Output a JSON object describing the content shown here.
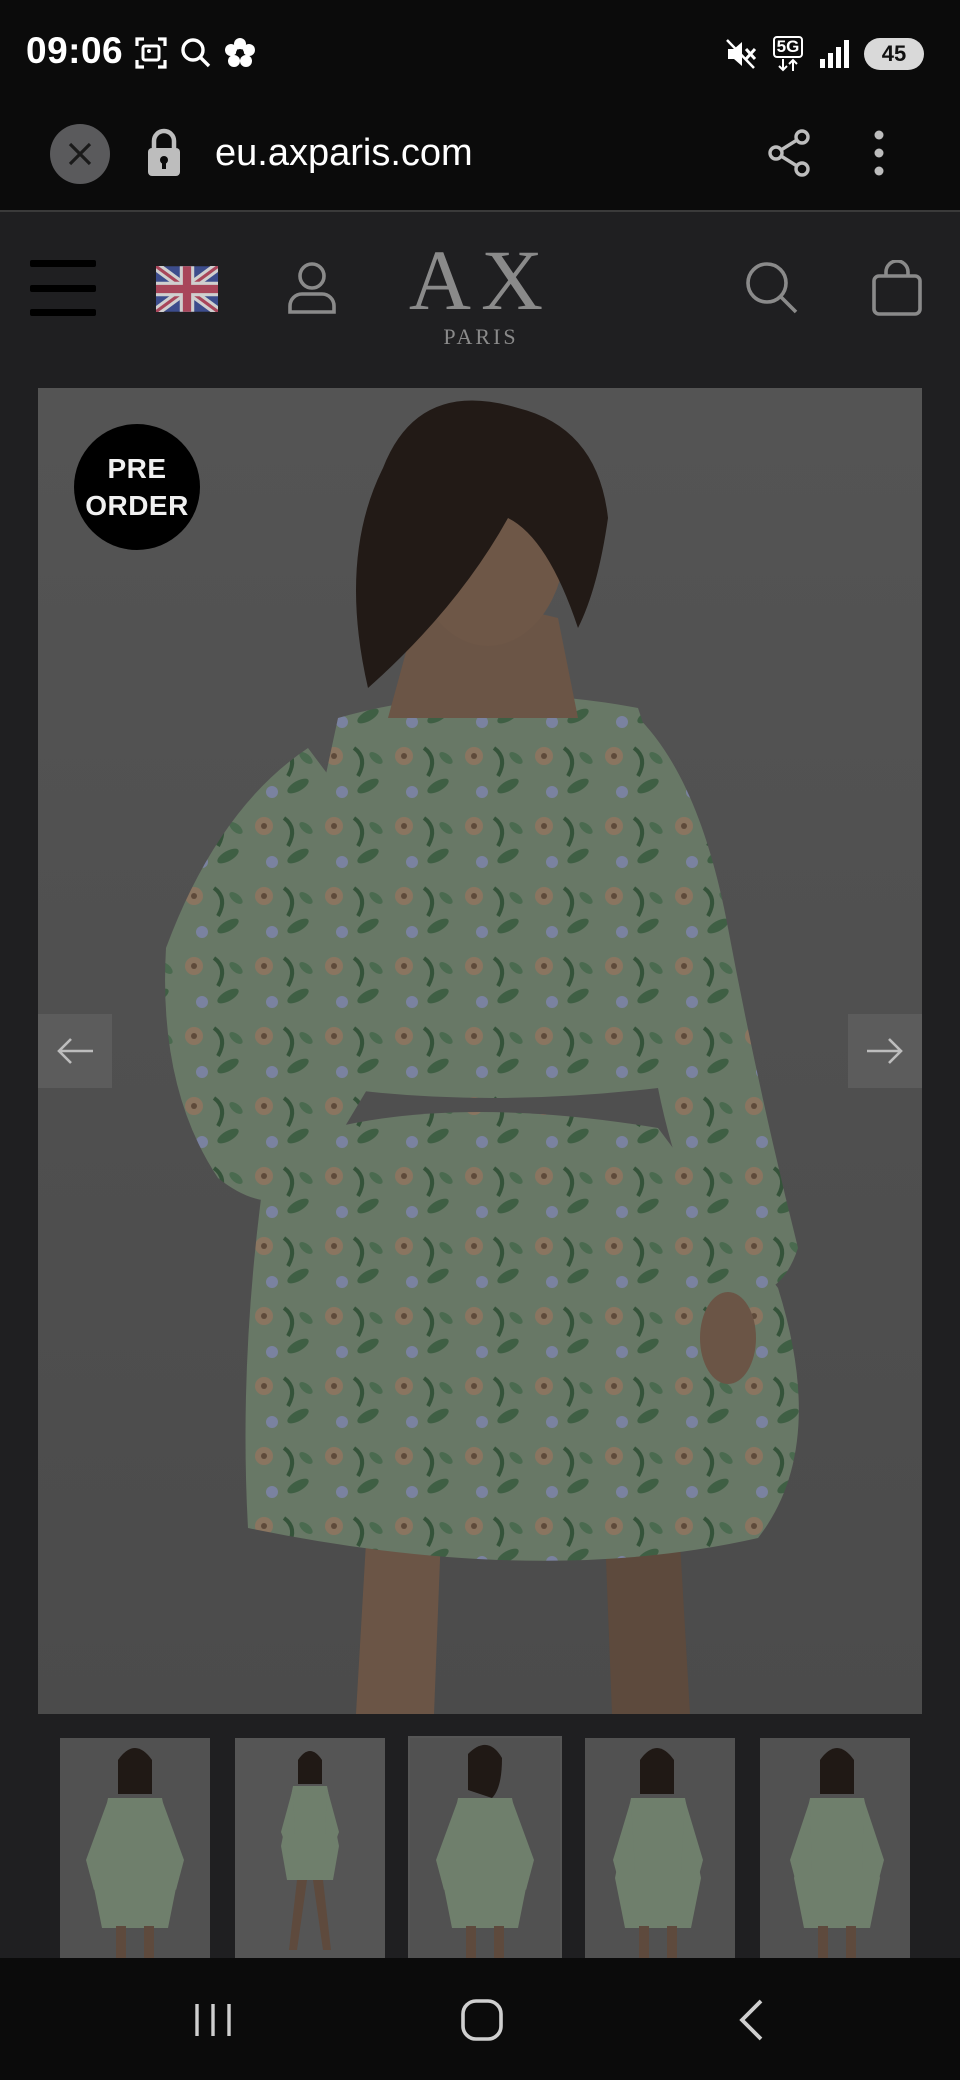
{
  "status_bar": {
    "time": "09:06",
    "network": "5G",
    "battery": "45",
    "icons_left": [
      "screenshot-icon",
      "search-icon",
      "flower-icon"
    ],
    "icons_right": [
      "mute-icon",
      "5g-icon",
      "signal-icon",
      "battery-icon"
    ]
  },
  "browser": {
    "url": "eu.axparis.com",
    "icons": [
      "close-icon",
      "lock-icon",
      "share-icon",
      "more-icon"
    ]
  },
  "site_header": {
    "logo_main": "AX",
    "logo_sub": "PARIS",
    "icons": [
      "hamburger-icon",
      "uk-flag-icon",
      "account-icon",
      "search-icon",
      "shopping-bag-icon"
    ]
  },
  "product": {
    "badge_line1": "PRE",
    "badge_line2": "ORDER",
    "image_alt": "Woman wearing a sage green floral print chiffon mini dress with ruffled long sleeves, back view",
    "thumbnails": [
      {
        "label": "front-view",
        "active": false
      },
      {
        "label": "full-length",
        "active": false
      },
      {
        "label": "back-view",
        "active": true
      },
      {
        "label": "side-view",
        "active": false
      },
      {
        "label": "three-quarter",
        "active": false
      }
    ]
  },
  "colors": {
    "overlay_dark": "#1f1f21",
    "dress_green": "#7a8a78",
    "image_bg": "#4e4e4e",
    "badge": "#000000"
  }
}
